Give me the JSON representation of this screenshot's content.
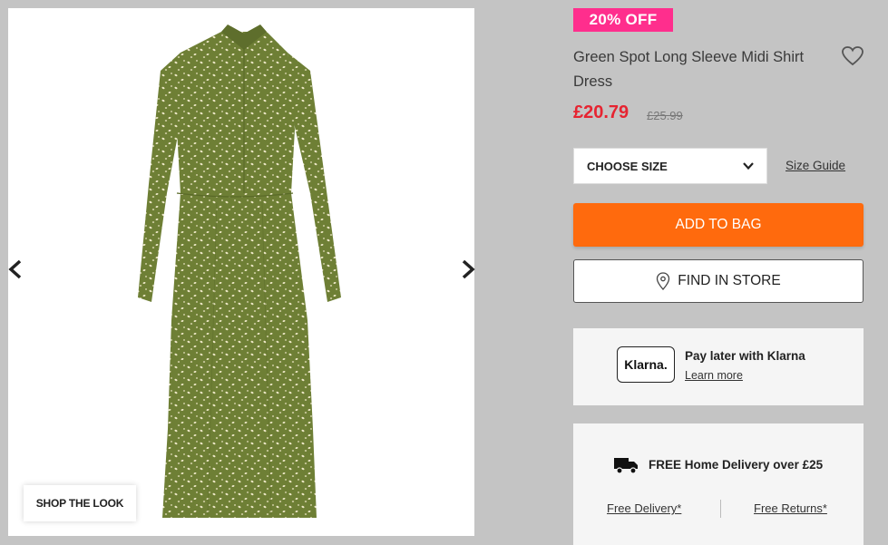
{
  "gallery": {
    "image_alt": "green-spot-dress-photo",
    "prev_icon": "chevron-left-icon",
    "next_icon": "chevron-right-icon",
    "shop_the_look_label": "SHOP THE LOOK"
  },
  "product": {
    "discount_badge": "20% OFF",
    "title": "Green Spot Long Sleeve Midi Shirt Dress",
    "price": "£20.79",
    "old_price": "£25.99",
    "wishlist_icon": "heart-outline-icon"
  },
  "size": {
    "select_label": "CHOOSE SIZE",
    "guide_label": "Size Guide"
  },
  "actions": {
    "add_to_bag_label": "ADD TO BAG",
    "find_in_store_label": "FIND IN STORE"
  },
  "klarna": {
    "logo_text": "Klarna.",
    "title": "Pay later with Klarna",
    "link": "Learn more"
  },
  "delivery": {
    "title": "FREE Home Delivery over £25",
    "free_delivery_link": "Free Delivery*",
    "free_returns_link": "Free Returns*"
  },
  "colors": {
    "badge": "#ff2e8d",
    "price": "#e62431",
    "add_to_bag": "#ff6a0d",
    "dress": "#6e7f35"
  }
}
